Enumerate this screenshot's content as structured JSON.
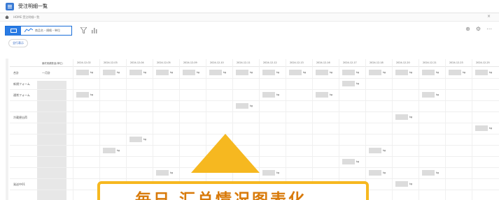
{
  "window": {
    "title": "受注明細一覧",
    "breadcrumb": "HOME 受注明細一覧",
    "close_icon": "×"
  },
  "toolbar": {
    "view_label": "商品名・規格・単位",
    "filter_button": "全行表示"
  },
  "right_icons": [
    "⊕",
    "⚙",
    "⋯"
  ],
  "grid": {
    "unit_header": "最終実績数量(単位)",
    "dates": [
      "2024-12-02",
      "2024-12-03",
      "2024-12-04",
      "2024-12-05",
      "2024-12-09",
      "2024-12-10",
      "2024-12-11",
      "2024-12-12",
      "2024-12-13",
      "2024-12-16",
      "2024-12-17",
      "2024-12-18",
      "2024-12-20",
      "2024-12-21",
      "2024-12-23",
      "2024-12-25"
    ],
    "rows": [
      {
        "label": "合計",
        "unit": "一月計"
      },
      {
        "label": "新規フォーム",
        "unit": ""
      },
      {
        "label": "通常フォーム",
        "unit": ""
      },
      {
        "label": "",
        "unit": ""
      },
      {
        "label": "冷蔵便出荷",
        "unit": ""
      },
      {
        "label": "",
        "unit": ""
      },
      {
        "label": "",
        "unit": ""
      },
      {
        "label": "",
        "unit": ""
      },
      {
        "label": "",
        "unit": ""
      },
      {
        "label": "",
        "unit": ""
      },
      {
        "label": "発送中01",
        "unit": ""
      }
    ],
    "unit_suffix": "kg"
  },
  "callout": {
    "text": "毎日 汇总情况图表化"
  },
  "colors": {
    "accent": "#2a7be4",
    "callout": "#f6b820",
    "callout_text": "#d87a0a"
  }
}
